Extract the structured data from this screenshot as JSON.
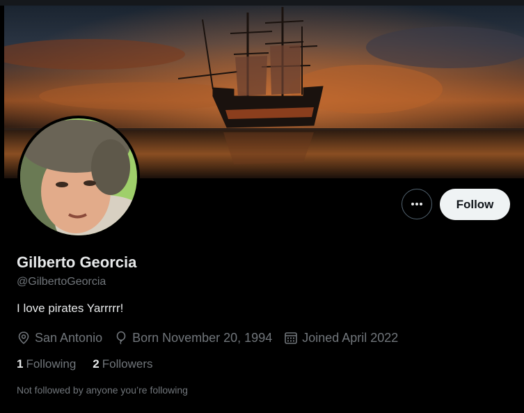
{
  "profile": {
    "display_name": "Gilberto Georcia",
    "handle": "@GilbertoGeorcia",
    "bio": "I love pirates Yarrrrr!",
    "location": "San Antonio",
    "birth": "Born November 20, 1994",
    "joined": "Joined April 2022"
  },
  "stats": {
    "following_count": "1",
    "following_label": "Following",
    "followers_count": "2",
    "followers_label": "Followers"
  },
  "follow_note": "Not followed by anyone you’re following",
  "actions": {
    "follow_label": "Follow",
    "more_icon": "more-horizontal-icon"
  },
  "icons": {
    "location": "location-pin-icon",
    "birth": "balloon-icon",
    "joined": "calendar-icon"
  },
  "colors": {
    "background": "#000000",
    "primary_text": "#e7e9ea",
    "secondary_text": "#71767b",
    "follow_button_bg": "#eff3f4",
    "follow_button_text": "#0f1419",
    "border": "#536471"
  }
}
